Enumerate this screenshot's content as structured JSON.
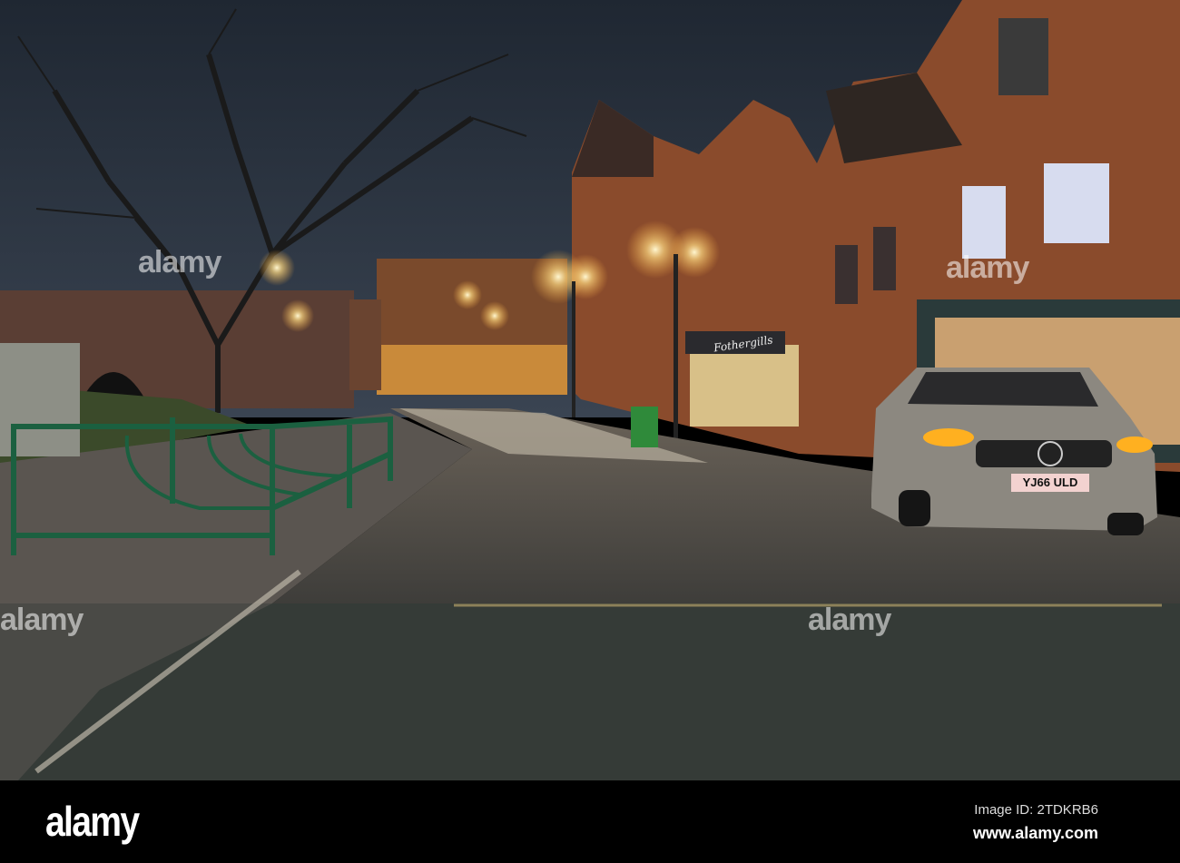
{
  "photo": {
    "pub_sign": "Fothergills",
    "license_plate": "YJ66 ULD",
    "watermark": "alamy",
    "colors": {
      "sky": "#27303d",
      "brick": "#8a4b2c",
      "road": "#4a4844",
      "cobbles": "#353b37",
      "lamp": "#ffe9a8"
    }
  },
  "footer": {
    "logo": "alamy",
    "image_id": "Image ID: 2TDKRB6",
    "website": "www.alamy.com"
  }
}
